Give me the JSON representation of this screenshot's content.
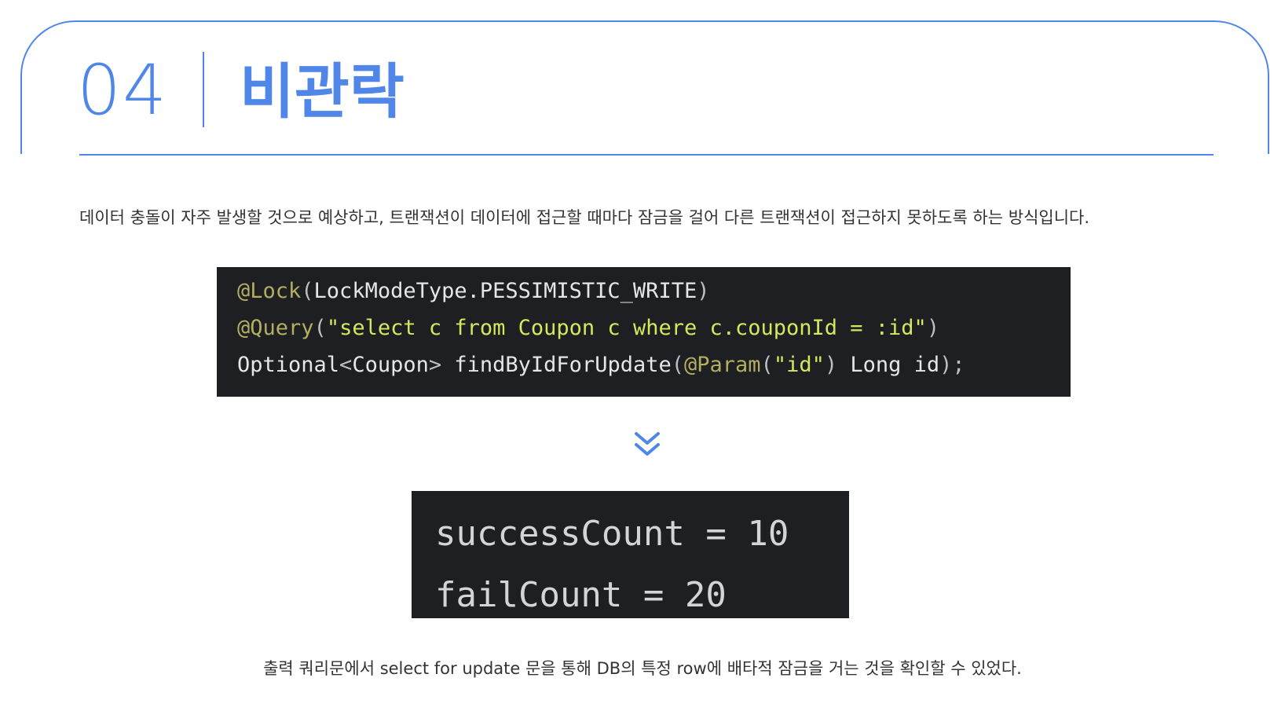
{
  "header": {
    "section_number": "04",
    "title": "비관락"
  },
  "description": "데이터 충돌이 자주 발생할 것으로 예상하고, 트랜잭션이 데이터에 접근할 때마다 잠금을 걸어 다른 트랜잭션이 접근하지 못하도록 하는 방식입니다.",
  "code": {
    "line1": {
      "annotation": "@Lock",
      "open": "(",
      "arg": "LockModeType.PESSIMISTIC_WRITE",
      "close": ")"
    },
    "line2": {
      "annotation": "@Query",
      "open": "(",
      "string": "\"select c from Coupon c where c.couponId = :id\"",
      "close": ")"
    },
    "line3": {
      "type": "Optional",
      "generic_open": "<",
      "generic_type": "Coupon",
      "generic_close": ">",
      "method": " findByIdForUpdate",
      "open": "(",
      "param_annotation": "@Param",
      "param_open": "(",
      "param_string": "\"id\"",
      "param_close": ")",
      "param_decl": " Long id",
      "close": ");"
    }
  },
  "arrow_icon": "double-chevron-down-icon",
  "result": {
    "success_line": "successCount = 10",
    "fail_line": "failCount = 20"
  },
  "caption": "출력 쿼리문에서 select for update 문을 통해 DB의 특정 row에 배타적 잠금을 거는 것을 확인할 수 있었다.",
  "colors": {
    "accent": "#4f86e8",
    "code_background": "#1e1f22",
    "annotation": "#b3ae60",
    "string": "#d5e85c"
  }
}
